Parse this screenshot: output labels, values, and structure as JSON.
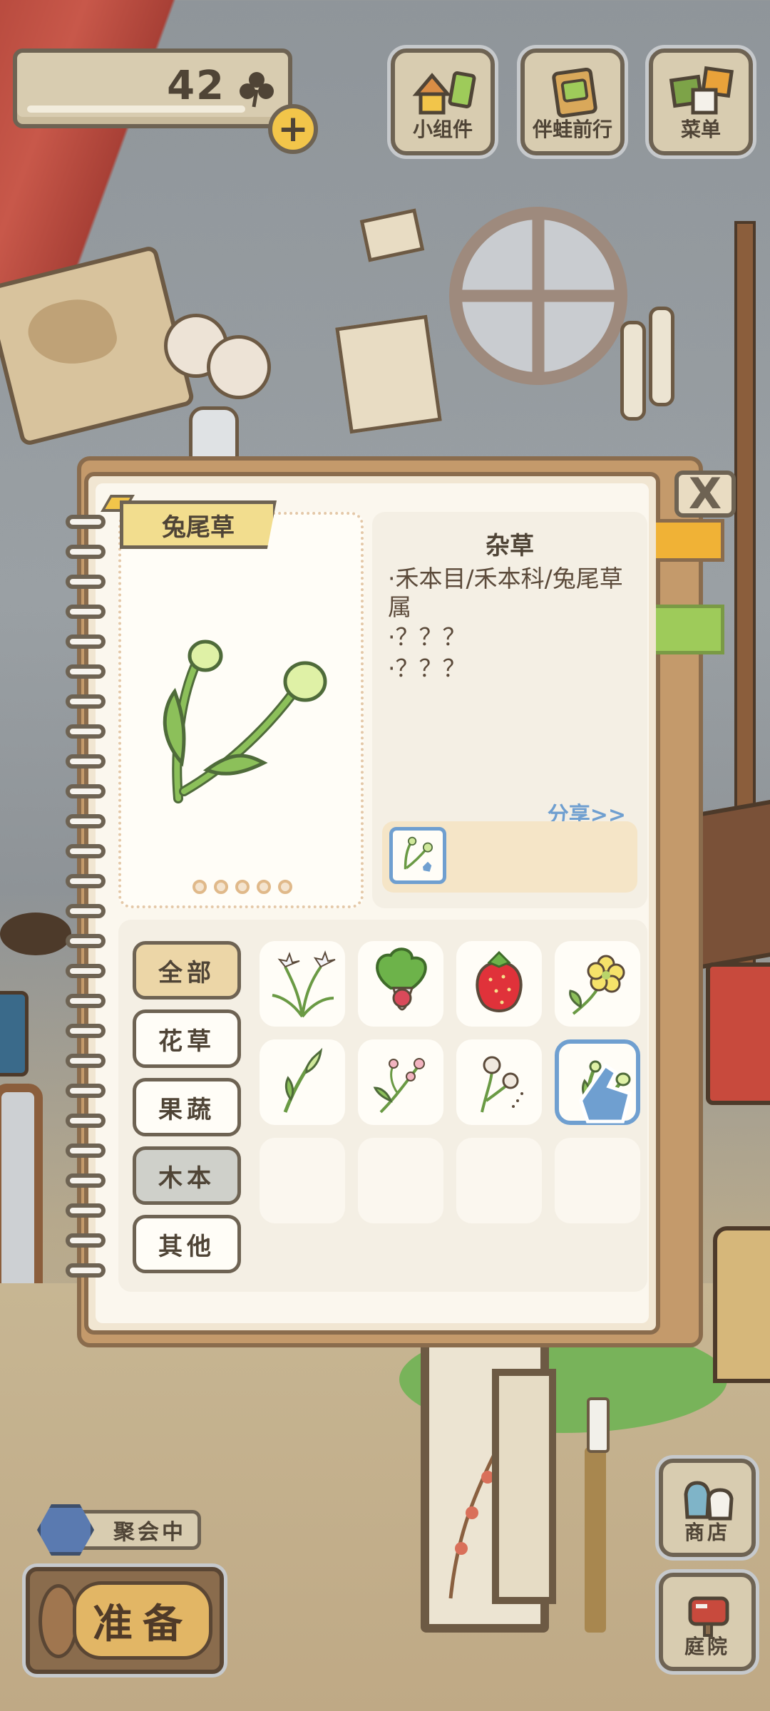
{
  "hud": {
    "clover_count": "42",
    "plus_label": "+",
    "buttons": [
      {
        "label": "小组件",
        "icon": "widget-icon"
      },
      {
        "label": "伴蛙前行",
        "icon": "travel-companion-icon"
      },
      {
        "label": "菜单",
        "icon": "menu-icon"
      }
    ]
  },
  "album": {
    "close_label": "X",
    "selected_item": {
      "name": "兔尾草",
      "category": "杂草",
      "details": [
        "·禾本目/禾本科/兔尾草属",
        "·？？？",
        "·？？？"
      ],
      "share_label": "分享>>",
      "page_dots": 5
    },
    "categories": [
      {
        "label": "全部",
        "state": "active"
      },
      {
        "label": "花草",
        "state": "normal"
      },
      {
        "label": "果蔬",
        "state": "normal"
      },
      {
        "label": "木本",
        "state": "muted"
      },
      {
        "label": "其他",
        "state": "normal"
      }
    ],
    "items": [
      {
        "icon": "snowdrop-flower-icon"
      },
      {
        "icon": "radish-icon"
      },
      {
        "icon": "strawberry-icon"
      },
      {
        "icon": "buttercup-flower-icon"
      },
      {
        "icon": "grass-sprout-icon"
      },
      {
        "icon": "pink-flower-sprig-icon"
      },
      {
        "icon": "dandelion-puff-icon"
      },
      {
        "icon": "bunny-tail-grass-icon",
        "selected": true
      },
      {
        "icon": "empty-slot"
      },
      {
        "icon": "empty-slot"
      },
      {
        "icon": "empty-slot"
      },
      {
        "icon": "empty-slot"
      }
    ]
  },
  "bottom": {
    "party_status": "聚会中",
    "ready_label": "准备",
    "side_buttons": [
      {
        "label": "商店",
        "icon": "shop-bags-icon"
      },
      {
        "label": "庭院",
        "icon": "mailbox-yard-icon"
      }
    ]
  },
  "colors": {
    "accent_blue": "#6f9fd0",
    "panel_beige": "#d8ccb0",
    "outline_brown": "#6e6353"
  }
}
